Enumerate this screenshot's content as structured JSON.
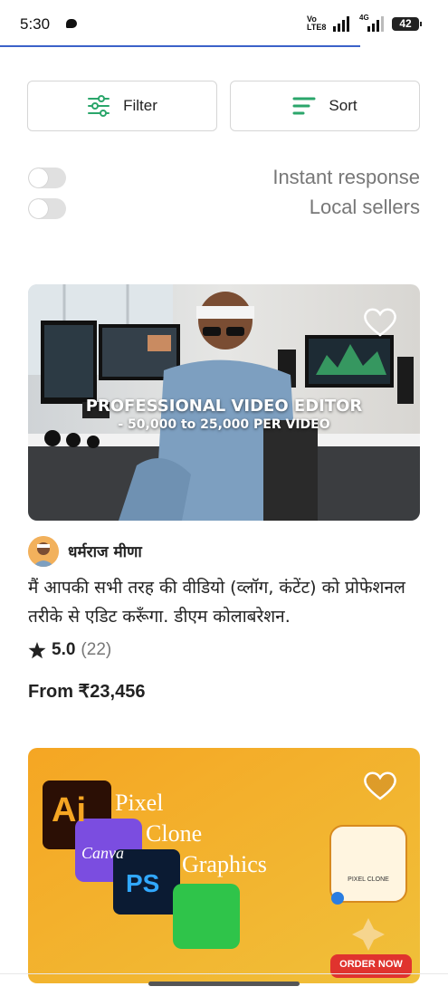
{
  "status": {
    "time": "5:30",
    "volte_line1": "Vo",
    "volte_line2": "LTE8",
    "net": "4G",
    "battery": "42"
  },
  "toolbar": {
    "filter_label": "Filter",
    "sort_label": "Sort"
  },
  "toggles": [
    {
      "label": "Instant response",
      "on": false
    },
    {
      "label": "Local sellers",
      "on": false
    }
  ],
  "cards": [
    {
      "image_title_line1": "PROFESSIONAL VIDEO EDITOR",
      "image_title_line2": "- 50,000 to 25,000 PER VIDEO",
      "seller": "धर्मराज मीणा",
      "description": "मैं आपकी सभी तरह की वीडियो (व्लॉग, कंटेंट) को प्रोफेशनल तरीके से एडिट करूँगा. डीएम कोलाबरेशन.",
      "rating": "5.0",
      "reviews": "(22)",
      "price": "From ₹23,456"
    },
    {
      "brand_line1": "Pixel",
      "brand_line2": "Clone",
      "brand_line3": "Graphics",
      "badge_ai": "Ai",
      "badge_canva": "Canva",
      "badge_ps": "PS",
      "logo_text": "PIXEL CLONE",
      "cta": "ORDER NOW"
    }
  ],
  "colors": {
    "accent": "#2ba66b",
    "progress": "#3b62c9"
  }
}
